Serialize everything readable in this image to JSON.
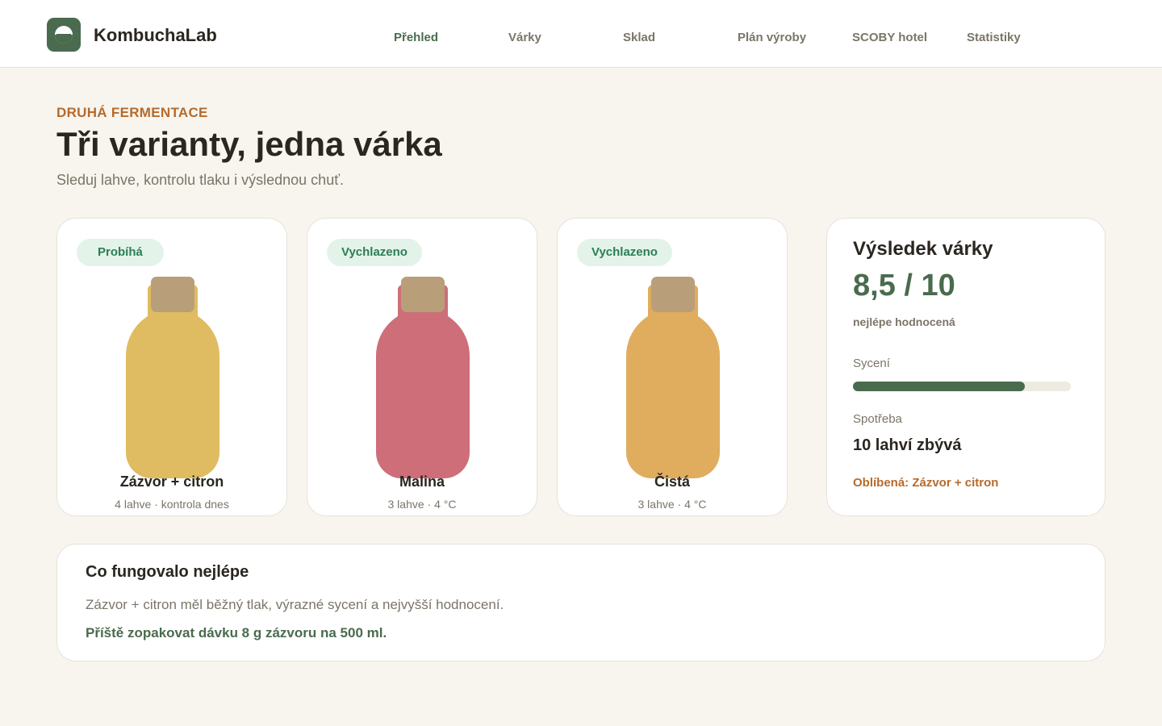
{
  "app": {
    "name": "KombuchaLab"
  },
  "nav": {
    "items": [
      {
        "label": "Přehled",
        "active": true
      },
      {
        "label": "Várky",
        "active": false
      },
      {
        "label": "Sklad",
        "active": false
      },
      {
        "label": "Plán výroby",
        "active": false
      },
      {
        "label": "SCOBY hotel",
        "active": false
      },
      {
        "label": "Statistiky",
        "active": false
      }
    ]
  },
  "hero": {
    "eyebrow": "DRUHÁ FERMENTACE",
    "title": "Tři varianty, jedna várka",
    "subtitle": "Sleduj lahve, kontrolu tlaku i výslednou chuť."
  },
  "bottles": [
    {
      "status": "Probíhá",
      "name": "Zázvor + citron",
      "meta": "4 lahve · kontrola dnes",
      "color": "#dfbc61"
    },
    {
      "status": "Vychlazeno",
      "name": "Malina",
      "meta": "3 lahve · 4 °C",
      "color": "#cd6e79"
    },
    {
      "status": "Vychlazeno",
      "name": "Čistá",
      "meta": "3 lahve · 4 °C",
      "color": "#e0ac5d"
    }
  ],
  "result": {
    "title": "Výsledek várky",
    "score": "8,5 / 10",
    "caption": "nejlépe hodnocená",
    "carbonation_label": "Sycení",
    "carbonation_level": 0.79,
    "consumption_label": "Spotřeba",
    "remaining": "10 lahví zbývá",
    "favorite": "Oblíbená: Zázvor + citron"
  },
  "insight": {
    "title": "Co fungovalo nejlépe",
    "text": "Zázvor + citron měl běžný tlak, výrazné sycení a nejvyšší hodnocení.",
    "action": "Příště zopakovat dávku 8 g zázvoru na 500 ml."
  },
  "colors": {
    "accent": "#4a6b4e",
    "warm": "#b66a2c",
    "badge_bg": "#e3f3ea",
    "badge_text": "#2c7e52"
  }
}
